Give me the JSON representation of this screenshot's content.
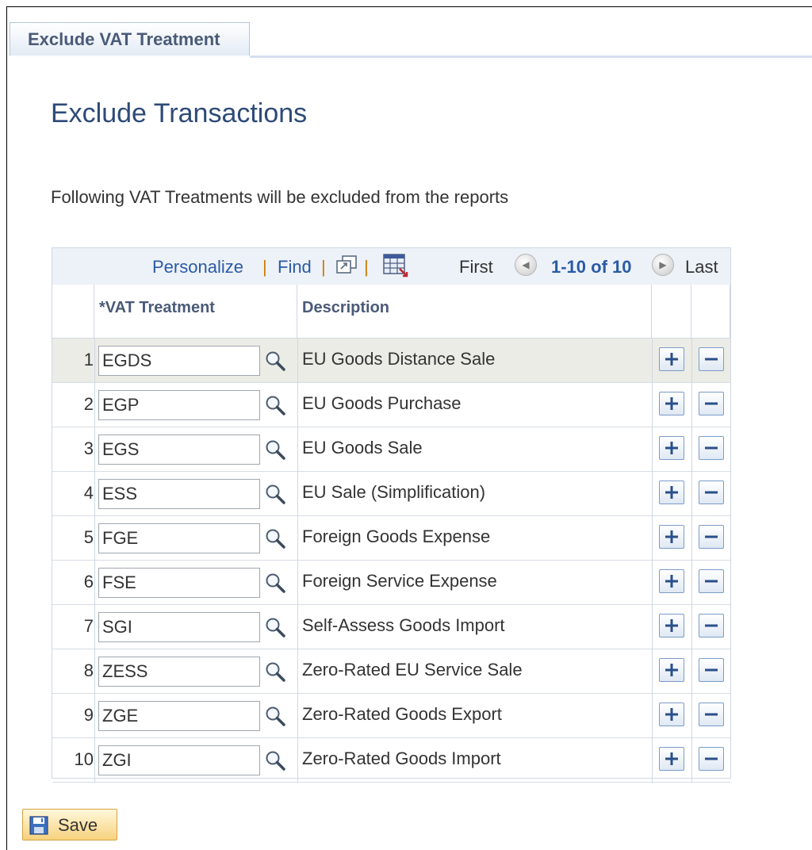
{
  "tab": {
    "label": "Exclude VAT Treatment"
  },
  "page": {
    "title": "Exclude Transactions",
    "info": "Following VAT Treatments will be excluded from the reports"
  },
  "grid": {
    "toolbar": {
      "personalize": "Personalize",
      "find": "Find",
      "separator": "|",
      "first": "First",
      "range": "1-10 of 10",
      "last": "Last"
    },
    "columns": {
      "vat_treatment": "*VAT Treatment",
      "description": "Description"
    },
    "rows": [
      {
        "num": "1",
        "code": "EGDS",
        "description": "EU Goods Distance Sale"
      },
      {
        "num": "2",
        "code": "EGP",
        "description": "EU Goods Purchase"
      },
      {
        "num": "3",
        "code": "EGS",
        "description": "EU Goods Sale"
      },
      {
        "num": "4",
        "code": "ESS",
        "description": "EU Sale (Simplification)"
      },
      {
        "num": "5",
        "code": "FGE",
        "description": "Foreign Goods Expense"
      },
      {
        "num": "6",
        "code": "FSE",
        "description": "Foreign Service Expense"
      },
      {
        "num": "7",
        "code": "SGI",
        "description": "Self-Assess Goods Import"
      },
      {
        "num": "8",
        "code": "ZESS",
        "description": "Zero-Rated EU Service Sale"
      },
      {
        "num": "9",
        "code": "ZGE",
        "description": "Zero-Rated Goods Export"
      },
      {
        "num": "10",
        "code": "ZGI",
        "description": "Zero-Rated Goods Import"
      }
    ]
  },
  "save": {
    "label": "Save"
  },
  "colors": {
    "link": "#2a5ba5",
    "title": "#2d4a78",
    "selected_row": "#ecece6"
  }
}
